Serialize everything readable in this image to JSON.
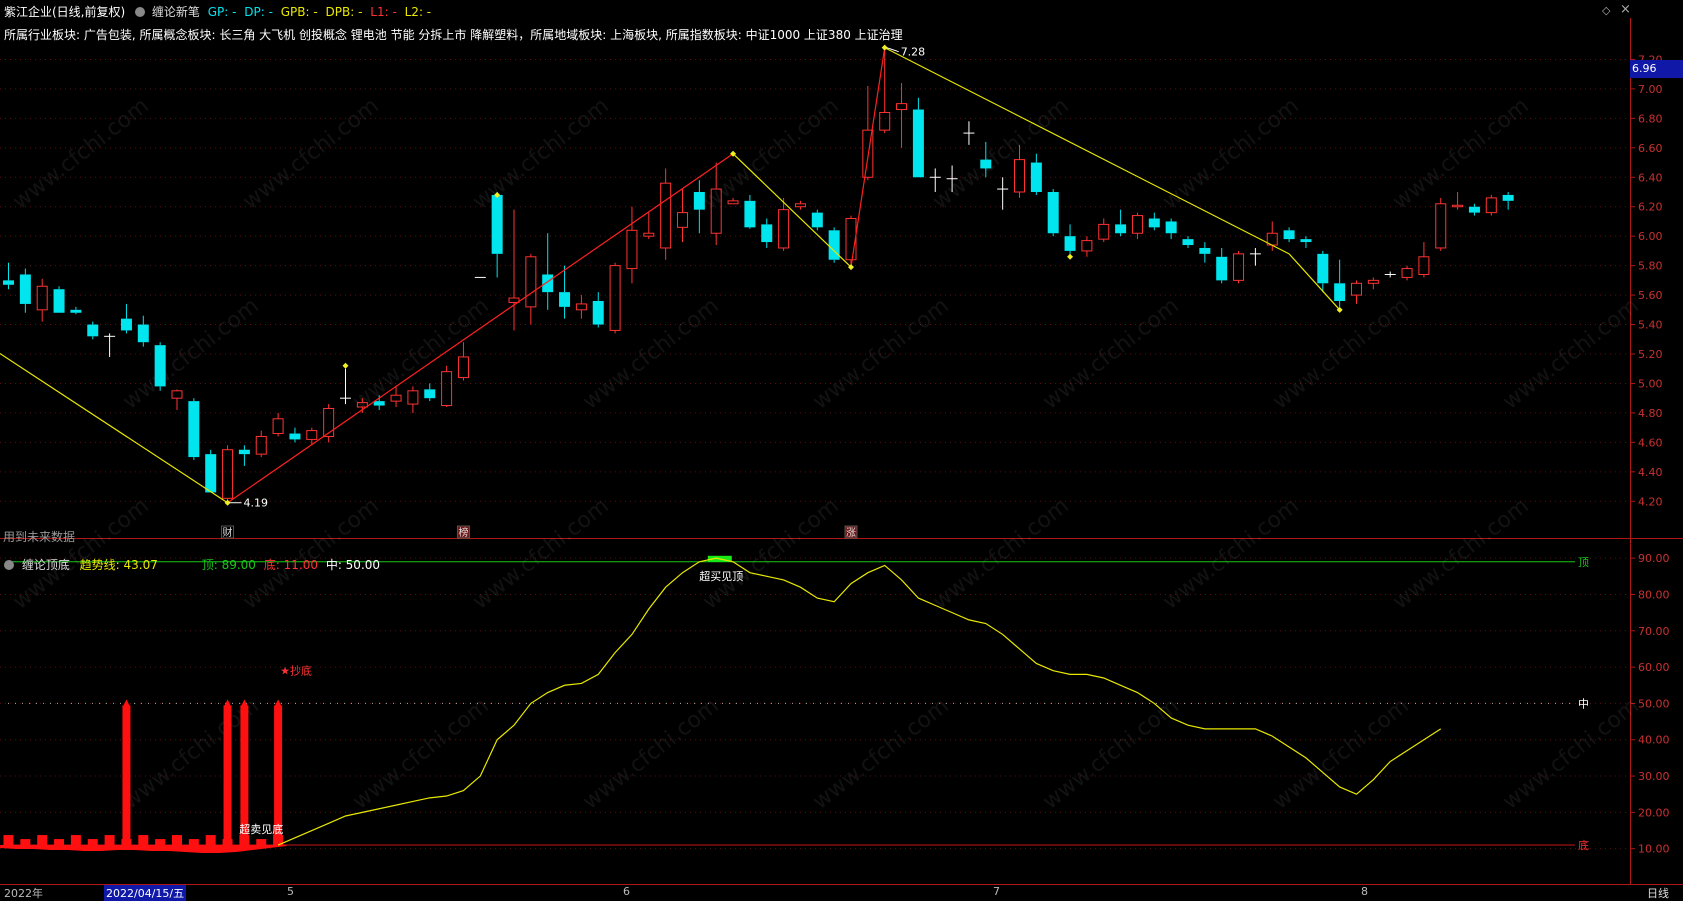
{
  "header": {
    "title": "紫江企业(日线,前复权)",
    "indicator": "缠论新笔",
    "gp": "GP: -",
    "dp": "DP: -",
    "gpb": "GPB: -",
    "dpb": "DPB: -",
    "l1": "L1: -",
    "l2": "L2: -",
    "sectors": "所属行业板块: 广告包装, 所属概念板块: 长三角 大飞机 创投概念 锂电池 节能 分拆上市 降解塑料，所属地域板块: 上海板块, 所属指数板块: 中证1000 上证380 上证治理",
    "future_note": "用到未来数据",
    "cai_marker": "财",
    "bang_marker": "榜",
    "zhang_marker": "涨"
  },
  "indicator_panel": {
    "name": "缠论顶底",
    "trend_label": "趋势线: 43.07",
    "top_label": "顶: 89.00",
    "bottom_label": "底: 11.00",
    "mid_label": "中: 50.00",
    "line_top": "顶",
    "line_mid": "中",
    "line_bottom": "底",
    "overbuy": "超买见顶",
    "oversell": "超卖见底",
    "chaodi": "★抄底"
  },
  "x_axis": {
    "year": "2022年",
    "cursor_date": "2022/04/15/五",
    "months": [
      "5",
      "6",
      "7",
      "8"
    ],
    "period": "日线"
  },
  "price_axis": {
    "current": "6.96",
    "high_label": "7.28",
    "low_label": "4.19"
  },
  "colors": {
    "up": "#ff3232",
    "down": "#00e5ee",
    "flat": "#ffffff",
    "bi": "#e8e800",
    "bi_up": "#ff2020",
    "trend": "#e8e800",
    "top_line": "#19c819",
    "bottom_line": "#c81414",
    "frame": "#b01818"
  },
  "chart_data": [
    {
      "type": "candlestick",
      "title": "紫江企业(日线,前复权)",
      "ylim": [
        4.1,
        7.4
      ],
      "y_ticks": [
        4.2,
        4.4,
        4.6,
        4.8,
        5.0,
        5.2,
        5.4,
        5.6,
        5.8,
        6.0,
        6.2,
        6.4,
        6.6,
        6.8,
        7.0,
        7.2
      ],
      "candles": [
        {
          "o": 5.7,
          "h": 5.82,
          "l": 5.64,
          "c": 5.67
        },
        {
          "o": 5.74,
          "h": 5.78,
          "l": 5.48,
          "c": 5.54
        },
        {
          "o": 5.5,
          "h": 5.71,
          "l": 5.42,
          "c": 5.66
        },
        {
          "o": 5.64,
          "h": 5.66,
          "l": 5.48,
          "c": 5.48
        },
        {
          "o": 5.5,
          "h": 5.52,
          "l": 5.47,
          "c": 5.48
        },
        {
          "o": 5.4,
          "h": 5.42,
          "l": 5.3,
          "c": 5.32
        },
        {
          "o": 5.32,
          "h": 5.34,
          "l": 5.18,
          "c": 5.32
        },
        {
          "o": 5.44,
          "h": 5.54,
          "l": 5.34,
          "c": 5.36
        },
        {
          "o": 5.4,
          "h": 5.46,
          "l": 5.25,
          "c": 5.28
        },
        {
          "o": 5.26,
          "h": 5.28,
          "l": 4.95,
          "c": 4.98
        },
        {
          "o": 4.9,
          "h": 4.96,
          "l": 4.82,
          "c": 4.95
        },
        {
          "o": 4.88,
          "h": 4.9,
          "l": 4.48,
          "c": 4.5
        },
        {
          "o": 4.52,
          "h": 4.55,
          "l": 4.26,
          "c": 4.26
        },
        {
          "o": 4.22,
          "h": 4.58,
          "l": 4.19,
          "c": 4.55
        },
        {
          "o": 4.55,
          "h": 4.58,
          "l": 4.44,
          "c": 4.52
        },
        {
          "o": 4.52,
          "h": 4.68,
          "l": 4.5,
          "c": 4.64
        },
        {
          "o": 4.66,
          "h": 4.8,
          "l": 4.64,
          "c": 4.76
        },
        {
          "o": 4.66,
          "h": 4.7,
          "l": 4.6,
          "c": 4.62
        },
        {
          "o": 4.62,
          "h": 4.7,
          "l": 4.58,
          "c": 4.68
        },
        {
          "o": 4.64,
          "h": 4.86,
          "l": 4.6,
          "c": 4.83
        },
        {
          "o": 4.9,
          "h": 5.1,
          "l": 4.86,
          "c": 4.9
        },
        {
          "o": 4.84,
          "h": 4.9,
          "l": 4.8,
          "c": 4.87
        },
        {
          "o": 4.88,
          "h": 4.92,
          "l": 4.82,
          "c": 4.85
        },
        {
          "o": 4.88,
          "h": 4.98,
          "l": 4.84,
          "c": 4.92
        },
        {
          "o": 4.86,
          "h": 4.98,
          "l": 4.8,
          "c": 4.95
        },
        {
          "o": 4.96,
          "h": 5.0,
          "l": 4.88,
          "c": 4.9
        },
        {
          "o": 4.85,
          "h": 5.12,
          "l": 4.84,
          "c": 5.08
        },
        {
          "o": 5.04,
          "h": 5.28,
          "l": 5.02,
          "c": 5.18
        },
        {
          "o": 5.72,
          "h": 5.72,
          "l": 5.72,
          "c": 5.72
        },
        {
          "o": 6.28,
          "h": 6.3,
          "l": 5.72,
          "c": 5.88
        },
        {
          "o": 5.55,
          "h": 6.18,
          "l": 5.36,
          "c": 5.58
        },
        {
          "o": 5.52,
          "h": 5.88,
          "l": 5.4,
          "c": 5.86
        },
        {
          "o": 5.74,
          "h": 6.02,
          "l": 5.5,
          "c": 5.62
        },
        {
          "o": 5.62,
          "h": 5.8,
          "l": 5.44,
          "c": 5.52
        },
        {
          "o": 5.5,
          "h": 5.6,
          "l": 5.44,
          "c": 5.54
        },
        {
          "o": 5.56,
          "h": 5.62,
          "l": 5.38,
          "c": 5.4
        },
        {
          "o": 5.36,
          "h": 5.82,
          "l": 5.34,
          "c": 5.8
        },
        {
          "o": 5.78,
          "h": 6.2,
          "l": 5.68,
          "c": 6.04
        },
        {
          "o": 6.0,
          "h": 6.16,
          "l": 5.98,
          "c": 6.02
        },
        {
          "o": 5.92,
          "h": 6.46,
          "l": 5.84,
          "c": 6.36
        },
        {
          "o": 6.06,
          "h": 6.32,
          "l": 5.96,
          "c": 6.16
        },
        {
          "o": 6.3,
          "h": 6.38,
          "l": 6.02,
          "c": 6.18
        },
        {
          "o": 6.02,
          "h": 6.5,
          "l": 5.94,
          "c": 6.32
        },
        {
          "o": 6.22,
          "h": 6.26,
          "l": 6.22,
          "c": 6.24
        },
        {
          "o": 6.24,
          "h": 6.28,
          "l": 6.05,
          "c": 6.06
        },
        {
          "o": 6.08,
          "h": 6.12,
          "l": 5.92,
          "c": 5.96
        },
        {
          "o": 5.92,
          "h": 6.26,
          "l": 5.9,
          "c": 6.18
        },
        {
          "o": 6.2,
          "h": 6.24,
          "l": 6.18,
          "c": 6.22
        },
        {
          "o": 6.16,
          "h": 6.18,
          "l": 6.04,
          "c": 6.06
        },
        {
          "o": 6.04,
          "h": 6.06,
          "l": 5.82,
          "c": 5.84
        },
        {
          "o": 5.84,
          "h": 6.14,
          "l": 5.8,
          "c": 6.12
        },
        {
          "o": 6.4,
          "h": 7.02,
          "l": 6.38,
          "c": 6.72
        },
        {
          "o": 6.72,
          "h": 7.28,
          "l": 6.7,
          "c": 6.84
        },
        {
          "o": 6.86,
          "h": 7.04,
          "l": 6.6,
          "c": 6.9
        },
        {
          "o": 6.86,
          "h": 6.94,
          "l": 6.4,
          "c": 6.4
        },
        {
          "o": 6.4,
          "h": 6.46,
          "l": 6.3,
          "c": 6.4
        },
        {
          "o": 6.39,
          "h": 6.48,
          "l": 6.3,
          "c": 6.39
        },
        {
          "o": 6.7,
          "h": 6.78,
          "l": 6.62,
          "c": 6.7
        },
        {
          "o": 6.52,
          "h": 6.64,
          "l": 6.4,
          "c": 6.46
        },
        {
          "o": 6.32,
          "h": 6.4,
          "l": 6.18,
          "c": 6.32
        },
        {
          "o": 6.3,
          "h": 6.62,
          "l": 6.26,
          "c": 6.52
        },
        {
          "o": 6.5,
          "h": 6.56,
          "l": 6.28,
          "c": 6.3
        },
        {
          "o": 6.3,
          "h": 6.32,
          "l": 6.0,
          "c": 6.02
        },
        {
          "o": 6.0,
          "h": 6.08,
          "l": 5.86,
          "c": 5.9
        },
        {
          "o": 5.9,
          "h": 6.0,
          "l": 5.86,
          "c": 5.97
        },
        {
          "o": 5.98,
          "h": 6.12,
          "l": 5.96,
          "c": 6.08
        },
        {
          "o": 6.08,
          "h": 6.18,
          "l": 6.0,
          "c": 6.02
        },
        {
          "o": 6.02,
          "h": 6.16,
          "l": 5.98,
          "c": 6.14
        },
        {
          "o": 6.12,
          "h": 6.16,
          "l": 6.04,
          "c": 6.06
        },
        {
          "o": 6.1,
          "h": 6.12,
          "l": 5.98,
          "c": 6.02
        },
        {
          "o": 5.98,
          "h": 6.0,
          "l": 5.92,
          "c": 5.94
        },
        {
          "o": 5.92,
          "h": 5.96,
          "l": 5.82,
          "c": 5.88
        },
        {
          "o": 5.86,
          "h": 5.92,
          "l": 5.68,
          "c": 5.7
        },
        {
          "o": 5.7,
          "h": 5.9,
          "l": 5.68,
          "c": 5.88
        },
        {
          "o": 5.88,
          "h": 5.92,
          "l": 5.8,
          "c": 5.88
        },
        {
          "o": 5.94,
          "h": 6.1,
          "l": 5.9,
          "c": 6.02
        },
        {
          "o": 6.04,
          "h": 6.06,
          "l": 5.96,
          "c": 5.98
        },
        {
          "o": 5.98,
          "h": 6.0,
          "l": 5.92,
          "c": 5.96
        },
        {
          "o": 5.88,
          "h": 5.9,
          "l": 5.62,
          "c": 5.68
        },
        {
          "o": 5.68,
          "h": 5.84,
          "l": 5.52,
          "c": 5.56
        },
        {
          "o": 5.6,
          "h": 5.7,
          "l": 5.54,
          "c": 5.68
        },
        {
          "o": 5.68,
          "h": 5.72,
          "l": 5.64,
          "c": 5.7
        },
        {
          "o": 5.74,
          "h": 5.76,
          "l": 5.72,
          "c": 5.74
        },
        {
          "o": 5.72,
          "h": 5.8,
          "l": 5.7,
          "c": 5.78
        },
        {
          "o": 5.74,
          "h": 5.96,
          "l": 5.72,
          "c": 5.86
        },
        {
          "o": 5.92,
          "h": 6.26,
          "l": 5.9,
          "c": 6.22
        },
        {
          "o": 6.2,
          "h": 6.3,
          "l": 6.18,
          "c": 6.21
        },
        {
          "o": 6.2,
          "h": 6.22,
          "l": 6.14,
          "c": 6.16
        },
        {
          "o": 6.16,
          "h": 6.28,
          "l": 6.14,
          "c": 6.26
        },
        {
          "o": 6.28,
          "h": 6.3,
          "l": 6.18,
          "c": 6.24
        }
      ],
      "bi_points": [
        [
          -1,
          5.24
        ],
        [
          13,
          4.19
        ],
        [
          43,
          6.56
        ],
        [
          50,
          5.79
        ],
        [
          52,
          7.28
        ],
        [
          76,
          5.88
        ],
        [
          79,
          5.5
        ]
      ],
      "bi_up_segments": [
        [
          13,
          43
        ],
        [
          50,
          52
        ]
      ],
      "bi_markers": [
        [
          13,
          4.19
        ],
        [
          20,
          5.12
        ],
        [
          29,
          6.28
        ],
        [
          43,
          6.56
        ],
        [
          50,
          5.79
        ],
        [
          52,
          7.28
        ],
        [
          63,
          5.86
        ],
        [
          79,
          5.5
        ]
      ],
      "annotations": [
        {
          "text": "7.28",
          "index": 52,
          "value": 7.28
        },
        {
          "text": "4.19",
          "index": 13,
          "value": 4.19
        }
      ]
    },
    {
      "type": "line",
      "title": "缠论顶底",
      "ylim": [
        0,
        95
      ],
      "y_ticks": [
        10,
        20,
        30,
        40,
        50,
        60,
        70,
        80,
        90
      ],
      "thresholds": {
        "top": 89,
        "mid": 50,
        "bottom": 11
      },
      "series": [
        {
          "name": "趋势线",
          "values": [
            null,
            null,
            null,
            null,
            null,
            null,
            null,
            null,
            null,
            null,
            null,
            null,
            null,
            null,
            null,
            null,
            11,
            13,
            15,
            17,
            19,
            20,
            21,
            22,
            23,
            24,
            24.5,
            26,
            30,
            40,
            44,
            50,
            53,
            55,
            55.5,
            58,
            64,
            69,
            76,
            82,
            86,
            89,
            90,
            89,
            86,
            85,
            84,
            82,
            79,
            78,
            83,
            86,
            88,
            84,
            79,
            77,
            75,
            73,
            72,
            69,
            65,
            61,
            59,
            58,
            58,
            57,
            55,
            53,
            50,
            46,
            44,
            43,
            43,
            43,
            43,
            41,
            38,
            35,
            31,
            27,
            25,
            29,
            34,
            37,
            40,
            43
          ]
        }
      ]
    }
  ]
}
